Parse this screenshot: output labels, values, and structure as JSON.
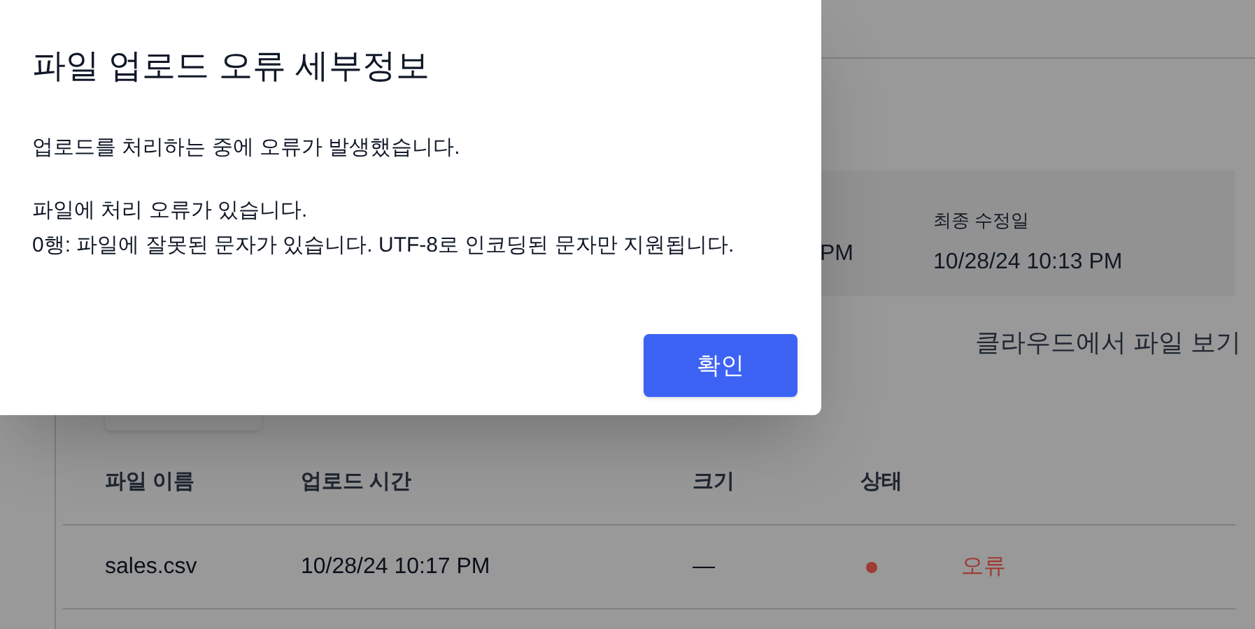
{
  "page": {
    "info_card": {
      "column_1_value": "PM",
      "last_modified_label": "최종 수정일",
      "last_modified_value": "10/28/24 10:13 PM"
    },
    "cloud_link": "클라우드에서 파일 보기",
    "table": {
      "columns": [
        "파일 이름",
        "업로드 시간",
        "크기",
        "상태"
      ],
      "rows": [
        {
          "file_name": "sales.csv",
          "upload_time": "10/28/24 10:17 PM",
          "size": "—",
          "status": "오류",
          "color": "#9e3b33"
        }
      ]
    }
  },
  "dialog": {
    "title": "파일 업로드 오류 세부정보",
    "message": "업로드를 처리하는 중에 오류가 발생했습니다.",
    "details": [
      "파일에 처리 오류가 있습니다.",
      "0행: 파일에 잘못된 문자가 있습니다. UTF-8로 인코딩된 문자만 지원됩니다."
    ],
    "button": "확인"
  }
}
